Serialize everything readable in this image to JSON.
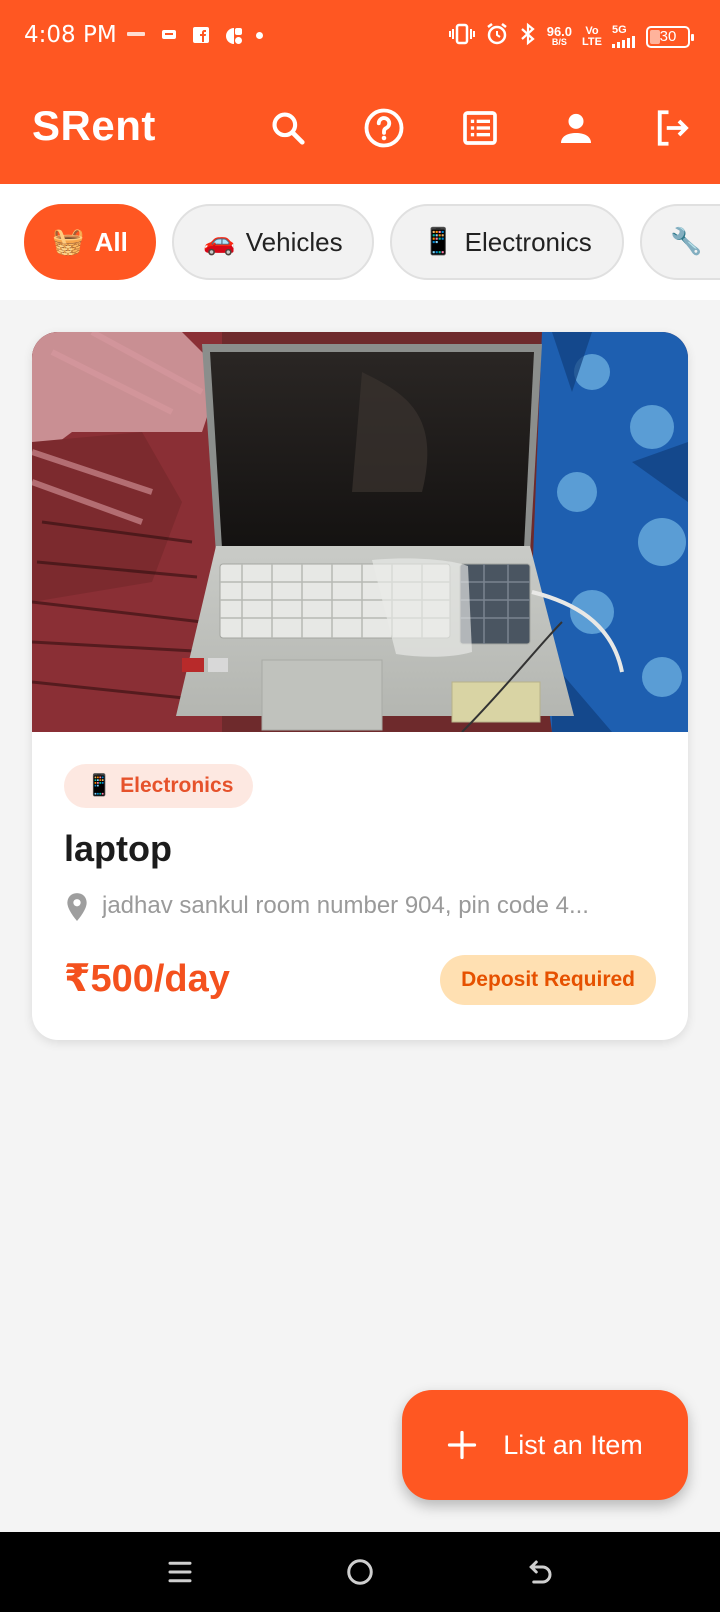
{
  "status_bar": {
    "time": "4:08 PM",
    "net_speed": "96.0",
    "net_unit": "B/S",
    "volte": "Vo\nLTE",
    "signal": "5G",
    "battery": "30"
  },
  "app_bar": {
    "title": "SRent",
    "icons": [
      "search-icon",
      "help-icon",
      "list-icon",
      "profile-icon",
      "logout-icon"
    ]
  },
  "filters": [
    {
      "emoji": "🧺",
      "label": "All",
      "active": true
    },
    {
      "emoji": "🚗",
      "label": "Vehicles",
      "active": false
    },
    {
      "emoji": "📱",
      "label": "Electronics",
      "active": false
    },
    {
      "emoji": "🔧",
      "label": "",
      "active": false
    }
  ],
  "listing": {
    "photo": "laptop-photo",
    "category_emoji": "📱",
    "category": "Electronics",
    "title": "laptop",
    "location": "jadhav sankul room number 904, pin code 4...",
    "price": "₹500/day",
    "deposit_label": "Deposit Required"
  },
  "fab": {
    "label": "List an Item"
  },
  "colors": {
    "primary": "#ff5722",
    "price": "#f4511e",
    "deposit_bg": "#ffe0b2",
    "deposit_text": "#e65100",
    "background": "#f4f4f4"
  }
}
